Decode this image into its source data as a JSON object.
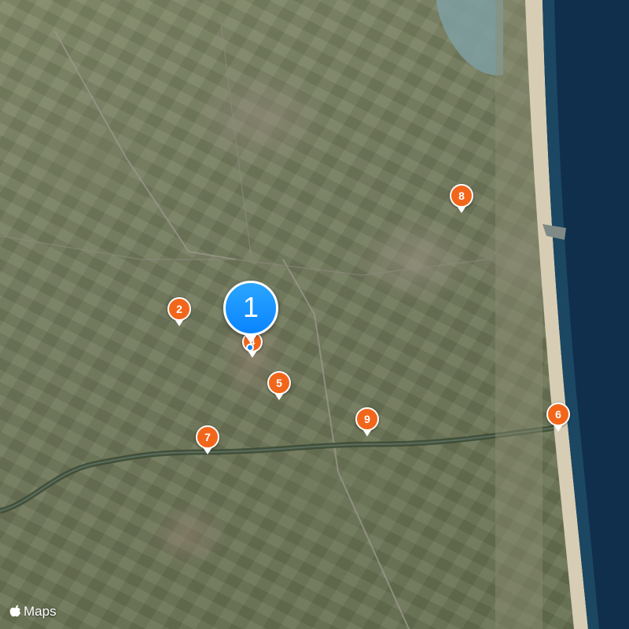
{
  "map": {
    "style": "satellite",
    "colors": {
      "pin_orange": "#f2661b",
      "pin_blue": "#0a84ff",
      "sea": "#0f2f4d",
      "beach": "#d7cdb4"
    },
    "selected_pin": {
      "label": "1",
      "icon": "map-pin-selected-icon"
    },
    "pins": [
      {
        "label": "2",
        "icon": "map-pin-icon"
      },
      {
        "label": "4",
        "icon": "map-pin-icon"
      },
      {
        "label": "5",
        "icon": "map-pin-icon"
      },
      {
        "label": "6",
        "icon": "map-pin-icon"
      },
      {
        "label": "7",
        "icon": "map-pin-icon"
      },
      {
        "label": "8",
        "icon": "map-pin-icon"
      },
      {
        "label": "9",
        "icon": "map-pin-icon"
      }
    ],
    "current_location": {
      "icon": "current-location-dot-icon"
    },
    "attribution": {
      "text": "Maps",
      "icon": "apple-logo-icon"
    }
  }
}
